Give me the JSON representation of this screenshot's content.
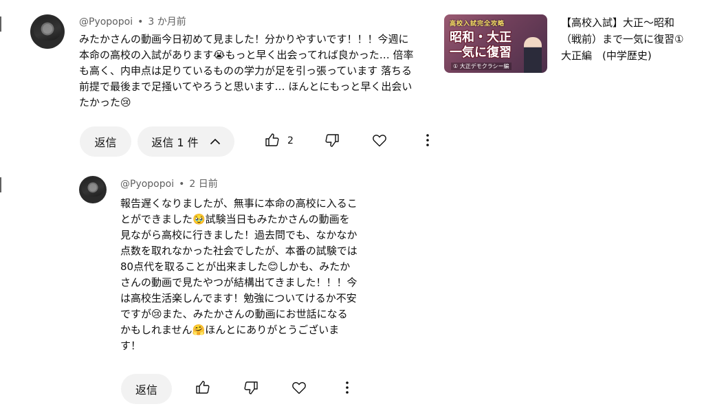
{
  "comment": {
    "author": "@Pyopopoi",
    "time": "3 か月前",
    "lines": [
      "みたかさんの動画今日初めて見ました！分かりやすいです！！！今週に",
      "本命の高校の入試があります😭もっと早く出会ってれば良かった… 倍率",
      "も高く、内申点は足りているものの学力が足を引っ張っています 落ちる",
      "前提で最後まで足掻いてやろうと思います… ほんとにもっと早く出会い",
      "たかった😢"
    ],
    "reply_label": "返信",
    "replies_toggle_label": "返信 1 件",
    "like_count": "2"
  },
  "reply": {
    "author": "@Pyopopoi",
    "time": "2 日前",
    "lines": [
      "報告遅くなりましたが、無事に本命の高校に入るこ",
      "とができました🥹試験当日もみたかさんの動画を",
      "見ながら高校に行きました！過去問でも、なかなか",
      "点数を取れなかった社会でしたが、本番の試験では",
      "80点代を取ることが出来ました😊しかも、みたか",
      "さんの動画で見たやつが結構出てきました！！！今",
      "は高校生活楽しんでます！勉強についてけるか不安",
      "ですが😢また、みたかさんの動画にお世話になる",
      "かもしれません🤗ほんとにありがとうございま",
      "す！"
    ],
    "reply_label": "返信"
  },
  "video": {
    "thumbnail": {
      "tag": "高校入試完全攻略",
      "line1": "昭和・大正",
      "line2": "一気に復習",
      "sub": "① 大正デモクラシー編"
    },
    "title_lines": [
      "【高校入試】大正〜昭和",
      "（戦前）まで一気に復習①",
      "大正編　(中学歴史)"
    ]
  },
  "icons": {
    "like": "thumbs-up-icon",
    "dislike": "thumbs-down-icon",
    "heart": "heart-icon",
    "more": "more-vert-icon",
    "collapse": "chevron-up-icon"
  }
}
